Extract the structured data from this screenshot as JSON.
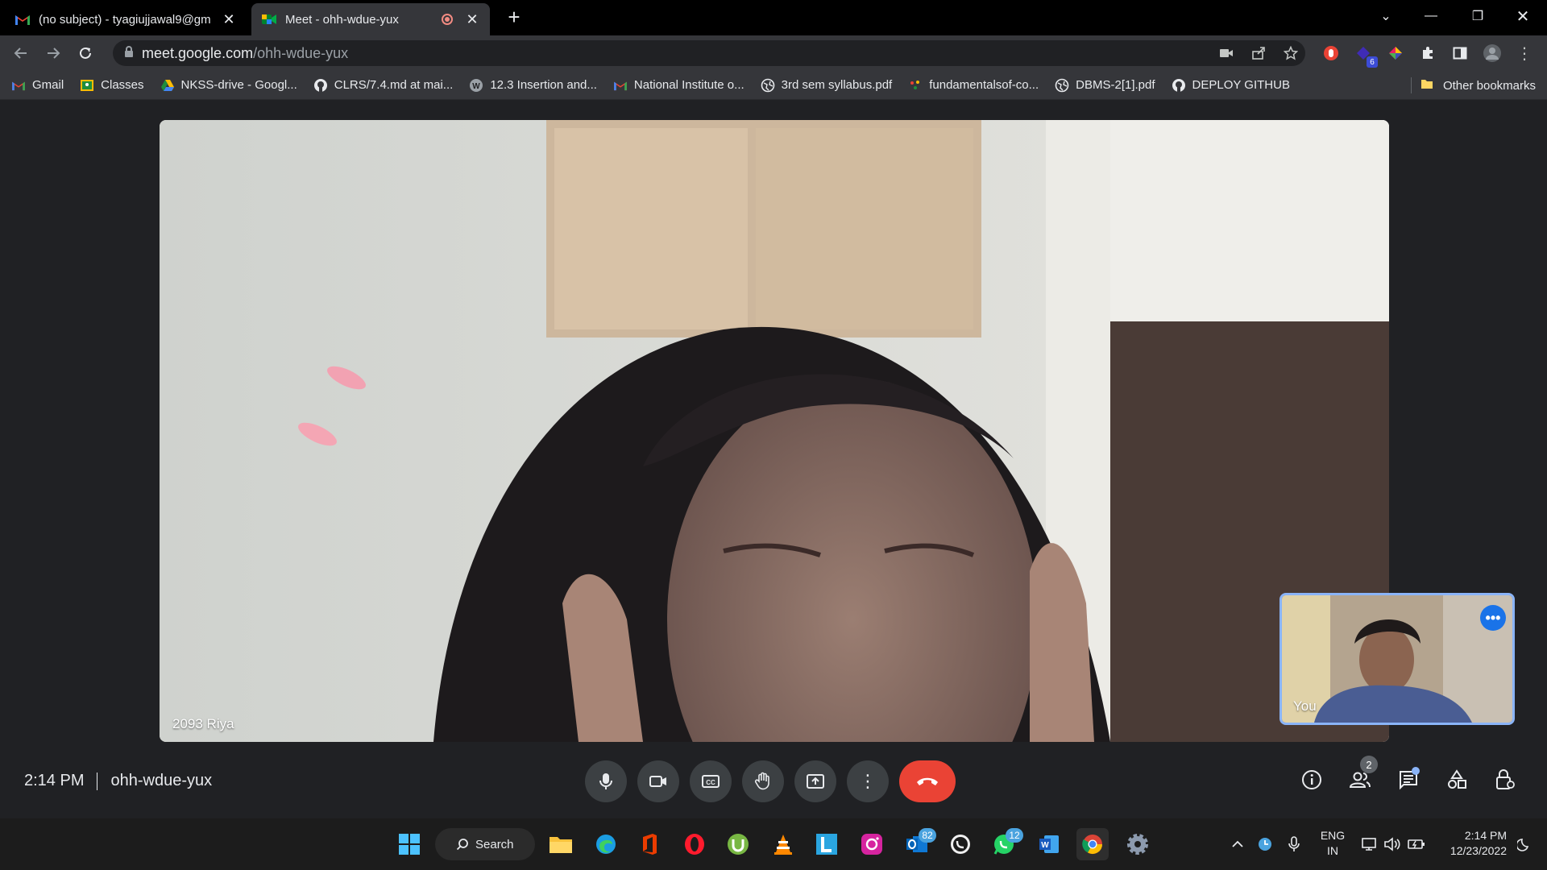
{
  "browser": {
    "tabs": [
      {
        "title": "(no subject) - tyagiujjawal9@gm",
        "icon": "gmail-icon"
      },
      {
        "title": "Meet - ohh-wdue-yux",
        "icon": "meet-icon"
      }
    ],
    "url_host": "meet.google.com",
    "url_path": "/ohh-wdue-yux",
    "extension_badge": "6",
    "bookmarks": [
      {
        "label": "Gmail",
        "icon": "gmail-icon"
      },
      {
        "label": "Classes",
        "icon": "classroom-icon"
      },
      {
        "label": "NKSS-drive - Googl...",
        "icon": "drive-icon"
      },
      {
        "label": "CLRS/7.4.md at mai...",
        "icon": "github-icon"
      },
      {
        "label": "12.3 Insertion and...",
        "icon": "w-icon"
      },
      {
        "label": "National Institute o...",
        "icon": "gmail-icon"
      },
      {
        "label": "3rd sem syllabus.pdf",
        "icon": "globe-icon"
      },
      {
        "label": "fundamentalsof-co...",
        "icon": "dots-icon"
      },
      {
        "label": "DBMS-2[1].pdf",
        "icon": "globe-icon"
      },
      {
        "label": "DEPLOY GITHUB",
        "icon": "github-icon"
      }
    ],
    "other_bookmarks": "Other bookmarks"
  },
  "meet": {
    "main_participant": "2093 Riya",
    "self_label": "You",
    "time": "2:14 PM",
    "meeting_code": "ohh-wdue-yux",
    "people_count": "2"
  },
  "taskbar": {
    "search_label": "Search",
    "outlook_badge": "82",
    "whatsapp_badge": "12",
    "lang_top": "ENG",
    "lang_bottom": "IN",
    "clock_time": "2:14 PM",
    "clock_date": "12/23/2022"
  },
  "colors": {
    "accent": "#8ab4f8",
    "end_call": "#ea4335",
    "meet_bg": "#202124"
  }
}
